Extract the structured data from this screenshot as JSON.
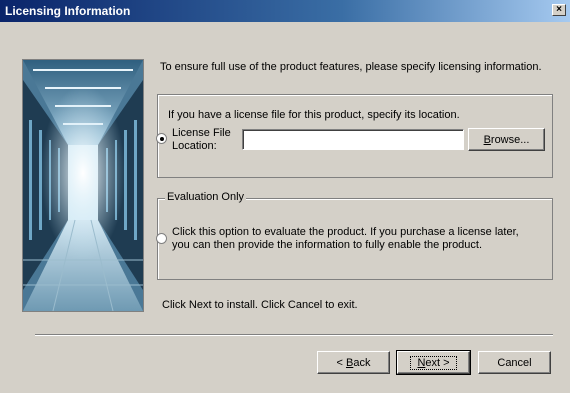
{
  "window": {
    "title": "Licensing Information",
    "close_glyph": "×"
  },
  "intro": "To ensure full use of the product features, please specify licensing information.",
  "license": {
    "description": "If you have a license file for this product, specify its location.",
    "label_line1": "License File",
    "label_line2": "Location:",
    "path_value": "",
    "browse_label_mnemonic": "B",
    "browse_label_rest": "rowse...",
    "selected": true
  },
  "evaluation": {
    "legend": "Evaluation Only",
    "line1": "Click this option to evaluate the product. If you purchase a license later,",
    "line2": "you can then provide the information to fully enable the product.",
    "selected": false
  },
  "footer": {
    "hint": "Click Next to install. Click Cancel to exit.",
    "back_prefix": "< ",
    "back_mnemonic": "B",
    "back_rest": "ack",
    "next_mnemonic": "N",
    "next_rest": "ext >",
    "cancel_label": "Cancel"
  },
  "icons": {
    "close": "close-icon",
    "side_image": "server-room-image"
  },
  "colors": {
    "dialog_bg": "#d4d0c8",
    "title_gradient_start": "#0a246a",
    "title_gradient_end": "#a6caf0"
  }
}
